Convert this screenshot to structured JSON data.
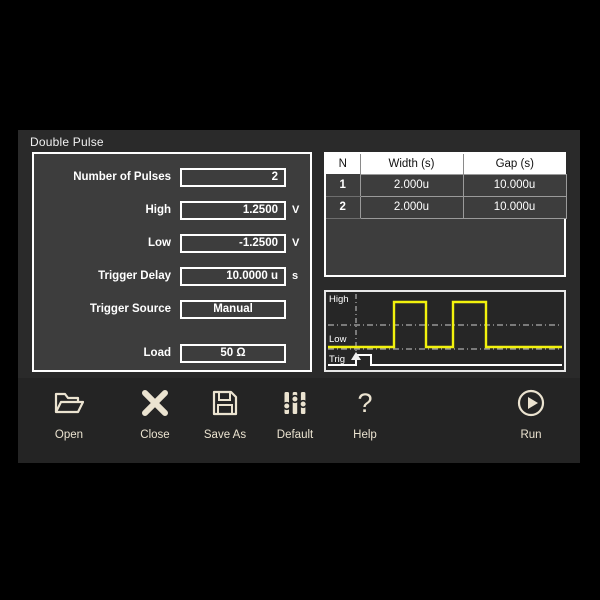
{
  "window": {
    "title": "Double Pulse"
  },
  "params": [
    {
      "label": "Number of Pulses",
      "value": "2",
      "unit": "",
      "align": "right"
    },
    {
      "label": "High",
      "value": "1.2500",
      "unit": "V",
      "align": "right"
    },
    {
      "label": "Low",
      "value": "-1.2500",
      "unit": "V",
      "align": "right"
    },
    {
      "label": "Trigger Delay",
      "value": "10.0000 u",
      "unit": "s",
      "align": "right"
    },
    {
      "label": "Trigger Source",
      "value": "Manual",
      "unit": "",
      "align": "center"
    },
    {
      "label": "Load",
      "value": "50 Ω",
      "unit": "",
      "align": "center"
    }
  ],
  "table": {
    "columns": [
      "N",
      "Width (s)",
      "Gap (s)"
    ],
    "rows": [
      {
        "n": "1",
        "width": "2.000u",
        "gap": "10.000u"
      },
      {
        "n": "2",
        "width": "2.000u",
        "gap": "10.000u"
      }
    ]
  },
  "waveform": {
    "labels": {
      "high": "High",
      "low": "Low",
      "trig": "Trig"
    },
    "trace_color": "#f2f20d",
    "trigger_color": "#ffffff",
    "grid_color": "#cfcfcf"
  },
  "toolbar": {
    "buttons": [
      {
        "label": "Open",
        "icon": "folder-open-icon"
      },
      {
        "label": "Close",
        "icon": "close-x-icon"
      },
      {
        "label": "Save As",
        "icon": "floppy-disk-icon"
      },
      {
        "label": "Default",
        "icon": "sliders-icon"
      },
      {
        "label": "Help",
        "icon": "question-mark-icon"
      },
      {
        "label": "Run",
        "icon": "play-circle-icon"
      }
    ]
  },
  "colors": {
    "window_bg": "#2a2a2a",
    "panel_bg": "#3d3d3d",
    "toolbar_bg": "#242424",
    "accent_cream": "#ebe3d0",
    "trace_yellow": "#f2f20d"
  }
}
